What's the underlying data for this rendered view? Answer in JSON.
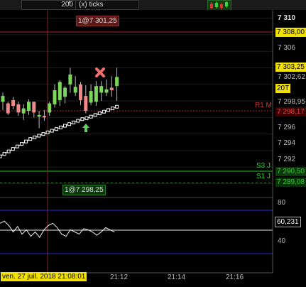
{
  "toolbar": {
    "size_value": "200",
    "unit_label": "(x) ticks",
    "scroll_up": "▲",
    "scroll_down": "▼",
    "chart_icon": "candlestick-chart-icon"
  },
  "price_axis": {
    "ticks": [
      "7 310",
      "7 306",
      "7 302,62",
      "7 298,95",
      "7 296",
      "7 294",
      "7 292"
    ],
    "right_rail": "7"
  },
  "price_tags": {
    "top_line": "7 308,00",
    "last": "7 303,25",
    "count_badge": "20T",
    "r1": "7 298,17",
    "s3": "7 290,50",
    "s1": "7 289,08"
  },
  "levels": {
    "r1": "R1 M",
    "s3": "S3 J",
    "s1": "S1 J"
  },
  "crosshair": {
    "top_label": "1@7 301,25",
    "bottom_label": "1@7 298,25",
    "time_label": "ven. 27 juil. 2018 21:08:01"
  },
  "indicator": {
    "ticks": [
      "80",
      "40"
    ],
    "value": "60,231"
  },
  "time_axis": {
    "ticks": [
      "21:12",
      "21:14",
      "21:16"
    ]
  },
  "colors": {
    "background": "#000000",
    "bull": "#7cd65a",
    "bear": "#f08a8a",
    "price_tag_yellow": "#f2e000",
    "level_green": "#1b7a1b",
    "level_red": "#a02020",
    "band_blue": "#2a2ad0"
  },
  "chart_data": {
    "type": "candlestick",
    "candles": [
      {
        "o": 7299.9,
        "h": 7301.0,
        "l": 7298.9,
        "c": 7300.6
      },
      {
        "o": 7299.7,
        "h": 7299.9,
        "l": 7298.3,
        "c": 7298.5
      },
      {
        "o": 7300.1,
        "h": 7300.5,
        "l": 7299.0,
        "c": 7299.4
      },
      {
        "o": 7299.6,
        "h": 7299.9,
        "l": 7298.2,
        "c": 7298.6
      },
      {
        "o": 7298.5,
        "h": 7299.6,
        "l": 7297.7,
        "c": 7299.1
      },
      {
        "o": 7298.8,
        "h": 7300.2,
        "l": 7298.3,
        "c": 7299.9
      },
      {
        "o": 7299.9,
        "h": 7299.9,
        "l": 7298.0,
        "c": 7298.6
      },
      {
        "o": 7298.1,
        "h": 7298.8,
        "l": 7296.7,
        "c": 7298.3
      },
      {
        "o": 7298.2,
        "h": 7298.9,
        "l": 7297.6,
        "c": 7298.0
      },
      {
        "o": 7298.6,
        "h": 7299.9,
        "l": 7298.2,
        "c": 7299.7
      },
      {
        "o": 7299.6,
        "h": 7302.0,
        "l": 7299.2,
        "c": 7301.3
      },
      {
        "o": 7300.1,
        "h": 7302.5,
        "l": 7299.4,
        "c": 7302.3
      },
      {
        "o": 7300.5,
        "h": 7301.8,
        "l": 7299.7,
        "c": 7301.6
      },
      {
        "o": 7302.0,
        "h": 7304.0,
        "l": 7301.0,
        "c": 7303.2
      },
      {
        "o": 7301.0,
        "h": 7303.0,
        "l": 7300.6,
        "c": 7301.7
      },
      {
        "o": 7302.0,
        "h": 7302.3,
        "l": 7299.5,
        "c": 7300.1
      },
      {
        "o": 7300.6,
        "h": 7301.9,
        "l": 7298.5,
        "c": 7298.8
      },
      {
        "o": 7299.8,
        "h": 7302.0,
        "l": 7299.5,
        "c": 7301.2
      },
      {
        "o": 7299.9,
        "h": 7302.4,
        "l": 7299.4,
        "c": 7301.8
      },
      {
        "o": 7301.0,
        "h": 7302.4,
        "l": 7300.0,
        "c": 7301.8
      },
      {
        "o": 7301.0,
        "h": 7302.6,
        "l": 7300.6,
        "c": 7301.4
      },
      {
        "o": 7301.6,
        "h": 7303.0,
        "l": 7300.5,
        "c": 7301.3
      },
      {
        "o": 7301.8,
        "h": 7304.0,
        "l": 7300.0,
        "c": 7302.9
      }
    ],
    "trend": [
      7293.3,
      7293.6,
      7293.9,
      7294.2,
      7294.5,
      7294.8,
      7295.1,
      7295.4,
      7295.6,
      7295.8,
      7296.0,
      7296.2,
      7296.4,
      7296.6,
      7296.8,
      7297.0,
      7297.2,
      7297.4,
      7297.6,
      7297.8,
      7297.9,
      7298.1,
      7298.3,
      7298.5,
      7298.7,
      7298.9,
      7299.1,
      7299.3
    ],
    "oscillator": [
      68,
      70,
      66,
      60,
      65,
      58,
      62,
      56,
      60,
      55,
      62,
      66,
      68,
      64,
      58,
      56,
      62,
      60,
      58,
      63,
      62,
      60,
      57,
      60,
      64,
      62,
      60
    ],
    "signals": {
      "sell_at": 7303.0,
      "buy_at": 7296.2
    },
    "ylim": [
      7288.5,
      7311.0
    ],
    "osc_ylim": [
      20,
      90
    ]
  }
}
